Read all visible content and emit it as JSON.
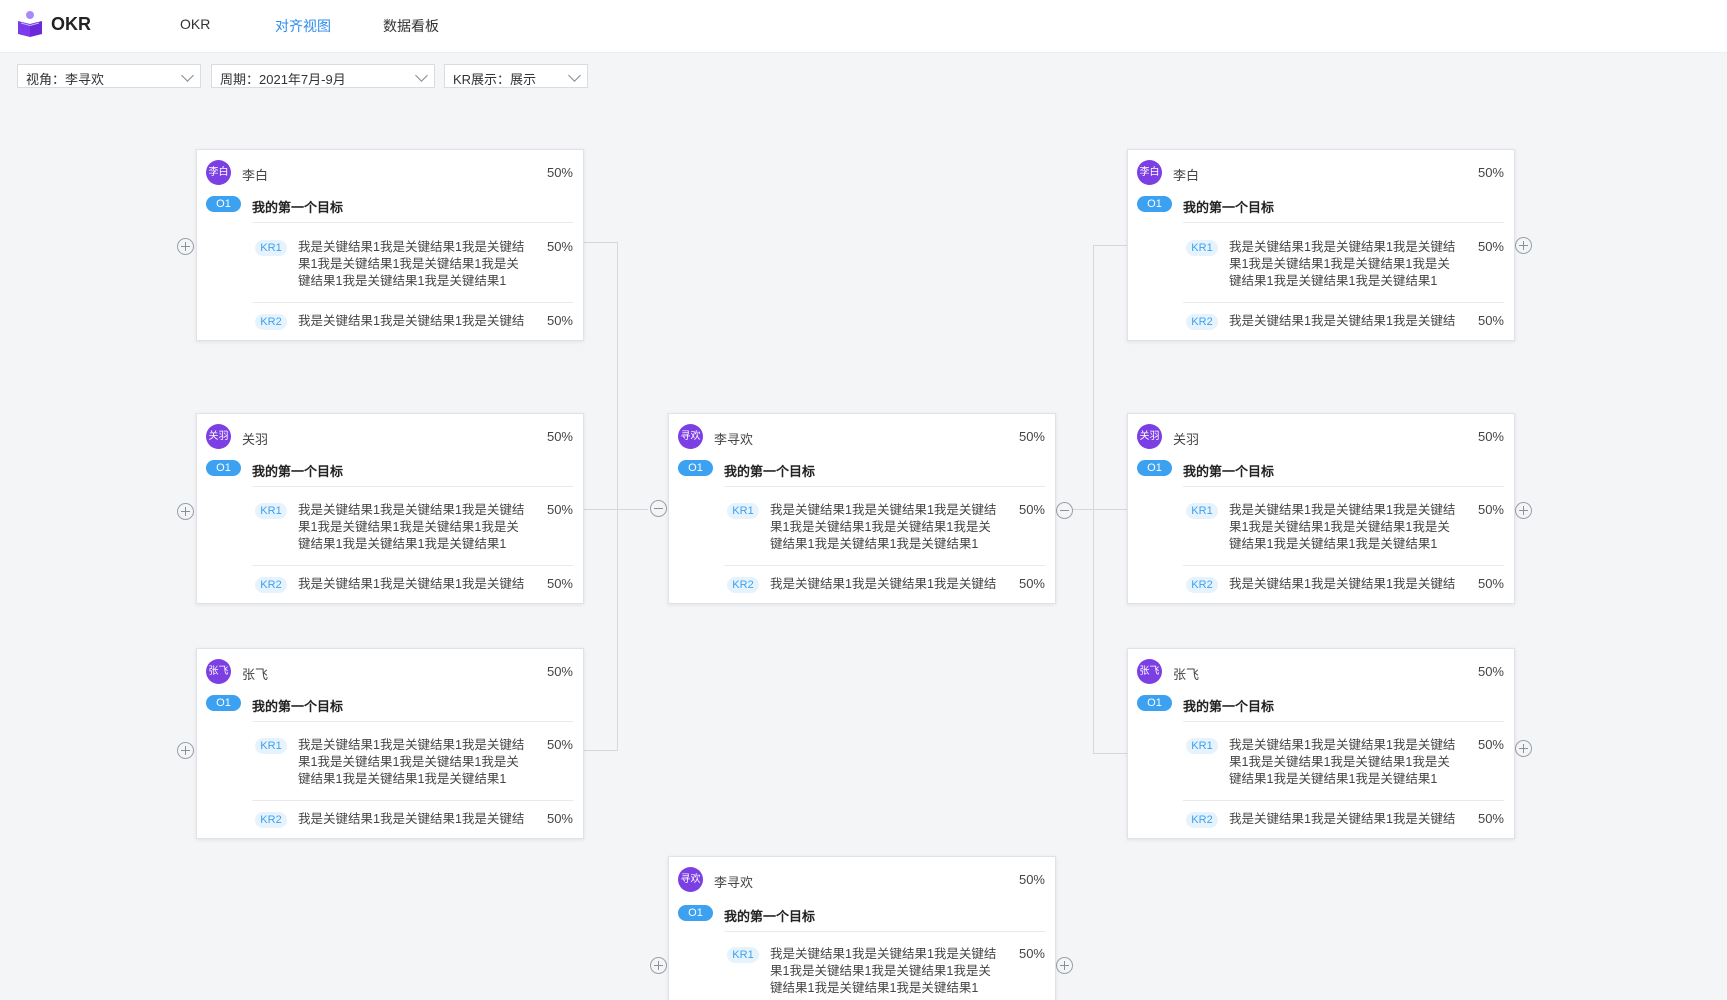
{
  "app": {
    "name": "OKR"
  },
  "nav": {
    "tabs": [
      {
        "label": "OKR"
      },
      {
        "label": "对齐视图"
      },
      {
        "label": "数据看板"
      }
    ]
  },
  "filters": {
    "view": "视角：李寻欢",
    "period": "周期：2021年7月-9月",
    "kr_display": "KR展示：展示"
  },
  "colors": {
    "accent": "#2d8cf0",
    "avatar": "#7b3fe4",
    "objective_badge": "#3ba1f0",
    "kr_badge_bg": "#e6f3fd"
  },
  "cards": [
    {
      "avatar": "李白",
      "owner": "李白",
      "progress": "50%",
      "objective": {
        "badge": "O1",
        "title": "我的第一个目标"
      },
      "krs": [
        {
          "badge": "KR1",
          "text": "我是关键结果1我是关键结果1我是关键结果1我是关键结果1我是关键结果1我是关键结果1我是关键结果1我是关键结果1",
          "progress": "50%"
        },
        {
          "badge": "KR2",
          "text": "我是关键结果1我是关键结果1我是关键结",
          "progress": "50%"
        }
      ]
    },
    {
      "avatar": "关羽",
      "owner": "关羽",
      "progress": "50%",
      "objective": {
        "badge": "O1",
        "title": "我的第一个目标"
      },
      "krs": [
        {
          "badge": "KR1",
          "text": "我是关键结果1我是关键结果1我是关键结果1我是关键结果1我是关键结果1我是关键结果1我是关键结果1我是关键结果1",
          "progress": "50%"
        },
        {
          "badge": "KR2",
          "text": "我是关键结果1我是关键结果1我是关键结",
          "progress": "50%"
        }
      ]
    },
    {
      "avatar": "张飞",
      "owner": "张飞",
      "progress": "50%",
      "objective": {
        "badge": "O1",
        "title": "我的第一个目标"
      },
      "krs": [
        {
          "badge": "KR1",
          "text": "我是关键结果1我是关键结果1我是关键结果1我是关键结果1我是关键结果1我是关键结果1我是关键结果1我是关键结果1",
          "progress": "50%"
        },
        {
          "badge": "KR2",
          "text": "我是关键结果1我是关键结果1我是关键结",
          "progress": "50%"
        }
      ]
    },
    {
      "avatar": "寻欢",
      "owner": "李寻欢",
      "progress": "50%",
      "objective": {
        "badge": "O1",
        "title": "我的第一个目标"
      },
      "krs": [
        {
          "badge": "KR1",
          "text": "我是关键结果1我是关键结果1我是关键结果1我是关键结果1我是关键结果1我是关键结果1我是关键结果1我是关键结果1",
          "progress": "50%"
        },
        {
          "badge": "KR2",
          "text": "我是关键结果1我是关键结果1我是关键结",
          "progress": "50%"
        }
      ]
    },
    {
      "avatar": "李白",
      "owner": "李白",
      "progress": "50%",
      "objective": {
        "badge": "O1",
        "title": "我的第一个目标"
      },
      "krs": [
        {
          "badge": "KR1",
          "text": "我是关键结果1我是关键结果1我是关键结果1我是关键结果1我是关键结果1我是关键结果1我是关键结果1我是关键结果1",
          "progress": "50%"
        },
        {
          "badge": "KR2",
          "text": "我是关键结果1我是关键结果1我是关键结",
          "progress": "50%"
        }
      ]
    },
    {
      "avatar": "关羽",
      "owner": "关羽",
      "progress": "50%",
      "objective": {
        "badge": "O1",
        "title": "我的第一个目标"
      },
      "krs": [
        {
          "badge": "KR1",
          "text": "我是关键结果1我是关键结果1我是关键结果1我是关键结果1我是关键结果1我是关键结果1我是关键结果1我是关键结果1",
          "progress": "50%"
        },
        {
          "badge": "KR2",
          "text": "我是关键结果1我是关键结果1我是关键结",
          "progress": "50%"
        }
      ]
    },
    {
      "avatar": "张飞",
      "owner": "张飞",
      "progress": "50%",
      "objective": {
        "badge": "O1",
        "title": "我的第一个目标"
      },
      "krs": [
        {
          "badge": "KR1",
          "text": "我是关键结果1我是关键结果1我是关键结果1我是关键结果1我是关键结果1我是关键结果1我是关键结果1我是关键结果1",
          "progress": "50%"
        },
        {
          "badge": "KR2",
          "text": "我是关键结果1我是关键结果1我是关键结",
          "progress": "50%"
        }
      ]
    },
    {
      "avatar": "寻欢",
      "owner": "李寻欢",
      "progress": "50%",
      "objective": {
        "badge": "O1",
        "title": "我的第一个目标"
      },
      "krs": [
        {
          "badge": "KR1",
          "text": "我是关键结果1我是关键结果1我是关键结果1我是关键结果1我是关键结果1我是关键结果1我是关键结果1我是关键结果1",
          "progress": "50%"
        }
      ]
    }
  ]
}
